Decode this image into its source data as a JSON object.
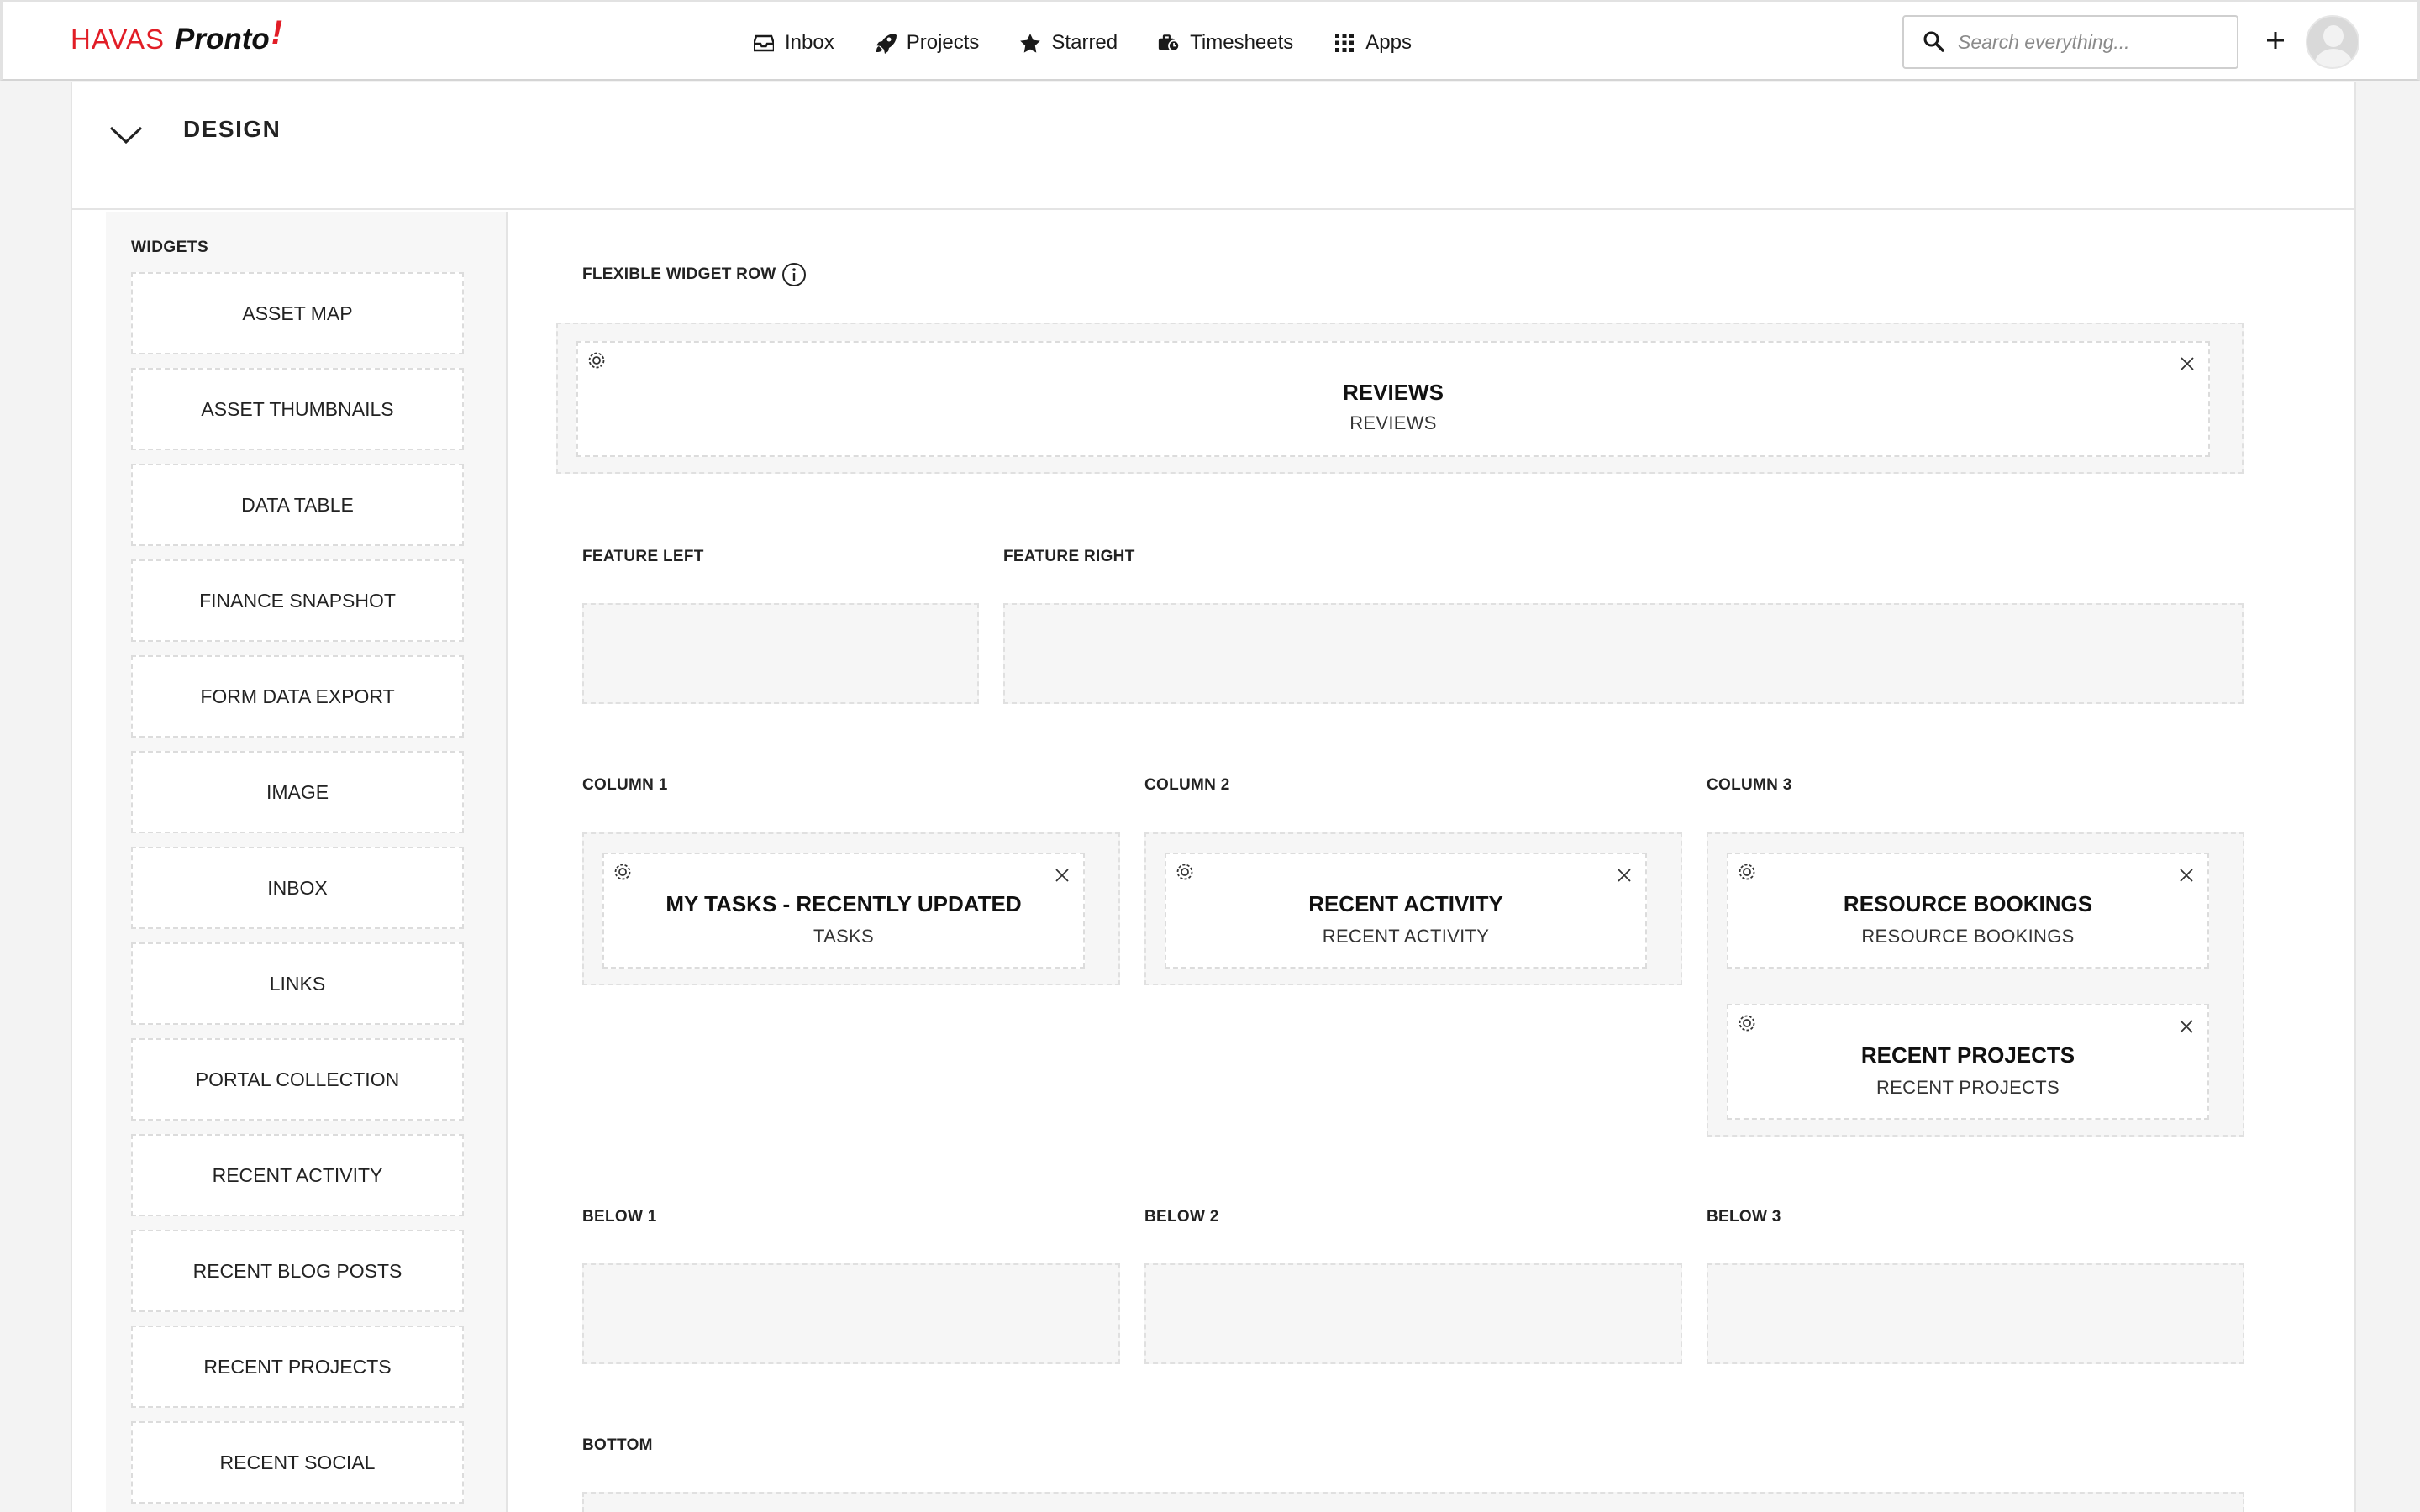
{
  "brand": {
    "havas": "HAVAS",
    "pronto": "Pronto",
    "bolt": "!"
  },
  "nav": {
    "items": [
      {
        "label": "Inbox",
        "icon": "inbox-icon"
      },
      {
        "label": "Projects",
        "icon": "rocket-icon"
      },
      {
        "label": "Starred",
        "icon": "star-icon"
      },
      {
        "label": "Timesheets",
        "icon": "time-tracker-icon"
      },
      {
        "label": "Apps",
        "icon": "grid-icon"
      }
    ]
  },
  "search": {
    "placeholder": "Search everything..."
  },
  "design": {
    "title": "DESIGN"
  },
  "sidebar": {
    "title": "WIDGETS",
    "items": [
      "ASSET MAP",
      "ASSET THUMBNAILS",
      "DATA TABLE",
      "FINANCE SNAPSHOT",
      "FORM DATA EXPORT",
      "IMAGE",
      "INBOX",
      "LINKS",
      "PORTAL COLLECTION",
      "RECENT ACTIVITY",
      "RECENT BLOG POSTS",
      "RECENT PROJECTS",
      "RECENT SOCIAL"
    ]
  },
  "zones": {
    "flexible": "FLEXIBLE WIDGET ROW",
    "feature_left": "FEATURE LEFT",
    "feature_right": "FEATURE RIGHT",
    "column1": "COLUMN 1",
    "column2": "COLUMN 2",
    "column3": "COLUMN 3",
    "below1": "BELOW 1",
    "below2": "BELOW 2",
    "below3": "BELOW 3",
    "bottom": "BOTTOM"
  },
  "widgets": {
    "reviews": {
      "title": "REVIEWS",
      "subtitle": "REVIEWS"
    },
    "my_tasks": {
      "title": "MY TASKS - RECENTLY UPDATED",
      "subtitle": "TASKS"
    },
    "recent_activity": {
      "title": "RECENT ACTIVITY",
      "subtitle": "RECENT ACTIVITY"
    },
    "resource_bookings": {
      "title": "RESOURCE BOOKINGS",
      "subtitle": "RESOURCE BOOKINGS"
    },
    "recent_projects": {
      "title": "RECENT PROJECTS",
      "subtitle": "RECENT PROJECTS"
    }
  },
  "colors": {
    "brand_red": "#e11d26",
    "dropzone_bg": "#f6f6f6",
    "border": "#dcdcdc"
  }
}
